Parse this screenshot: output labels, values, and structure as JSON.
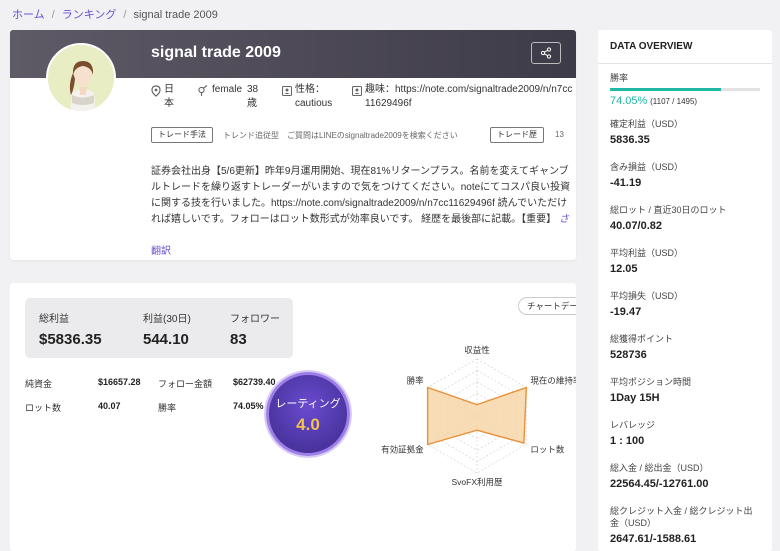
{
  "breadcrumb": {
    "home": "ホーム",
    "sep": "/",
    "ranking": "ランキング",
    "current": "signal trade 2009"
  },
  "profile": {
    "name": "signal trade 2009",
    "country": "日本",
    "gender": "female",
    "age": "38歳",
    "personality": "性格：cautious",
    "hobby": "趣味：https://note.com/signaltrade2009/n/n7cc11629496f",
    "tag1_label": "トレード手法",
    "tag1_text": "トレンド追従型　ご質問はLINEのsignaltrade2009を検索ください",
    "tag2_label": "トレード歴",
    "tag2_text": "13",
    "description": "証券会社出身【5/6更新】昨年9月運用開始、現在81%リターンプラス。名前を変えてギャンブルトレードを繰り返すトレーダーがいますので気をつけてください。noteにてコスパ良い投資に関する技を行いました。https://note.com/signaltrade2009/n/n7cc11629496f 読んでいただければ嬉しいです。フォローはロット数形式が効率良いです。 経歴を最後部に記載。【重要】",
    "more": "さらに表示",
    "translate": "翻訳"
  },
  "kpis": [
    {
      "label": "総利益",
      "value": "$5836.35"
    },
    {
      "label": "利益(30日)",
      "value": "544.10"
    },
    {
      "label": "フォロワー",
      "value": "83"
    }
  ],
  "details": {
    "equity_label": "純資金",
    "equity": "$16657.28",
    "follow_label": "フォロー金額",
    "follow": "$62739.40",
    "lots_label": "ロット数",
    "lots": "40.07",
    "win_label": "勝率",
    "win": "74.05%"
  },
  "rating": {
    "label": "レーティング",
    "value": "4.0"
  },
  "chart_button": "チャートデータ",
  "chart_data": {
    "type": "radar",
    "axes": [
      "収益性",
      "現在の維持率",
      "ロット数",
      "SvoFX利用歴",
      "有効証拠金",
      "勝率"
    ],
    "values": [
      0.2,
      1.0,
      0.95,
      0.25,
      1.0,
      1.0
    ],
    "range": [
      0,
      1
    ],
    "colors": {
      "fill": "#f6d6a8",
      "stroke": "#e8913a",
      "grid": "#cccccc"
    }
  },
  "overview": {
    "title": "DATA OVERVIEW",
    "win_label": "勝率",
    "win_pct": "74.05%",
    "win_count": "(1107 / 1495)",
    "win_fraction": 0.7405,
    "items": [
      {
        "label": "確定利益（USD）",
        "value": "5836.35"
      },
      {
        "label": "含み損益（USD）",
        "value": "-41.19"
      },
      {
        "label": "総ロット / 直近30日のロット",
        "value": "40.07/0.82"
      },
      {
        "label": "平均利益（USD）",
        "value": "12.05"
      },
      {
        "label": "平均損失（USD）",
        "value": "-19.47"
      },
      {
        "label": "総獲得ポイント",
        "value": "528736"
      },
      {
        "label": "平均ポジション時間",
        "value": "1Day 15H"
      },
      {
        "label": "レバレッジ",
        "value": "1 : 100"
      },
      {
        "label": "総入金 / 総出金（USD）",
        "value": "22564.45/-12761.00"
      },
      {
        "label": "総クレジット入金 / 総クレジット出金（USD）",
        "value": "2647.61/-1588.61"
      }
    ]
  },
  "colors": {
    "accent": "#6c4fcf",
    "header": "#4a4756",
    "win": "#1fb8a4"
  }
}
